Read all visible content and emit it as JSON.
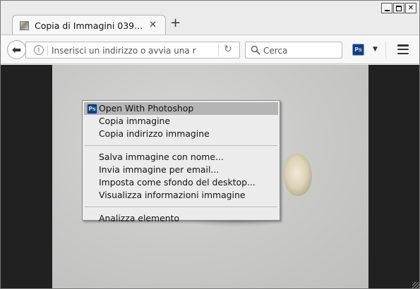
{
  "window": {
    "controls": [
      "minimize",
      "maximize",
      "close"
    ]
  },
  "tab": {
    "title": "Copia di Immagini 039...",
    "close_glyph": "✕",
    "new_tab_glyph": "+"
  },
  "navbar": {
    "url_placeholder": "Inserisci un indirizzo o avvia una r",
    "search_placeholder": "Cerca",
    "ps_button_label": "Ps"
  },
  "context_menu": {
    "items": [
      {
        "label": "Open With Photoshop",
        "highlighted": true,
        "icon": "photoshop-icon"
      },
      {
        "label": "Copia immagine"
      },
      {
        "label": "Copia indirizzo immagine"
      },
      {
        "label": "Salva immagine con nome..."
      },
      {
        "label": "Invia immagine per email..."
      },
      {
        "label": "Imposta come sfondo del desktop..."
      },
      {
        "label": "Visualizza informazioni immagine"
      },
      {
        "label": "Analizza elemento"
      }
    ]
  },
  "colors": {
    "page_bg": "#212121",
    "menu_highlight": "#b5b5b5",
    "chrome_bg": "#ebebeb"
  }
}
